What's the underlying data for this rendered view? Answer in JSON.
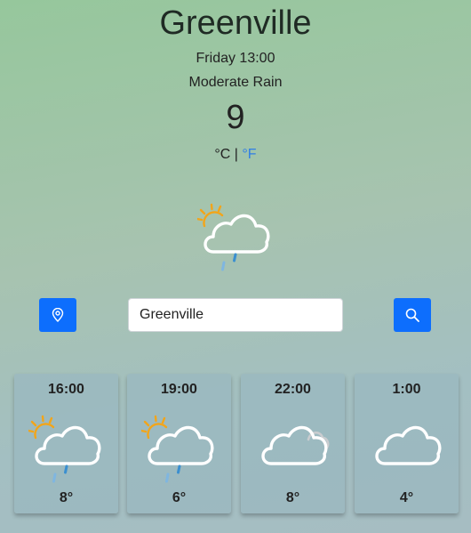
{
  "current": {
    "city": "Greenville",
    "datetime": "Friday 13:00",
    "condition": "Moderate Rain",
    "temperature": "9",
    "unit_c": "°C",
    "unit_separator": " | ",
    "unit_f": "°F",
    "icon": "sun-cloud-rain-icon"
  },
  "search": {
    "value": "Greenville"
  },
  "forecast": [
    {
      "time": "16:00",
      "temp": "8°",
      "icon": "sun-cloud-rain-icon"
    },
    {
      "time": "19:00",
      "temp": "6°",
      "icon": "sun-cloud-rain-icon"
    },
    {
      "time": "22:00",
      "temp": "8°",
      "icon": "clouds-icon"
    },
    {
      "time": "1:00",
      "temp": "4°",
      "icon": "cloud-icon"
    }
  ],
  "colors": {
    "accent": "#0d6efd",
    "link": "#2f7ee6",
    "sun": "#f2a51a",
    "rain": "#3a8fd0"
  }
}
